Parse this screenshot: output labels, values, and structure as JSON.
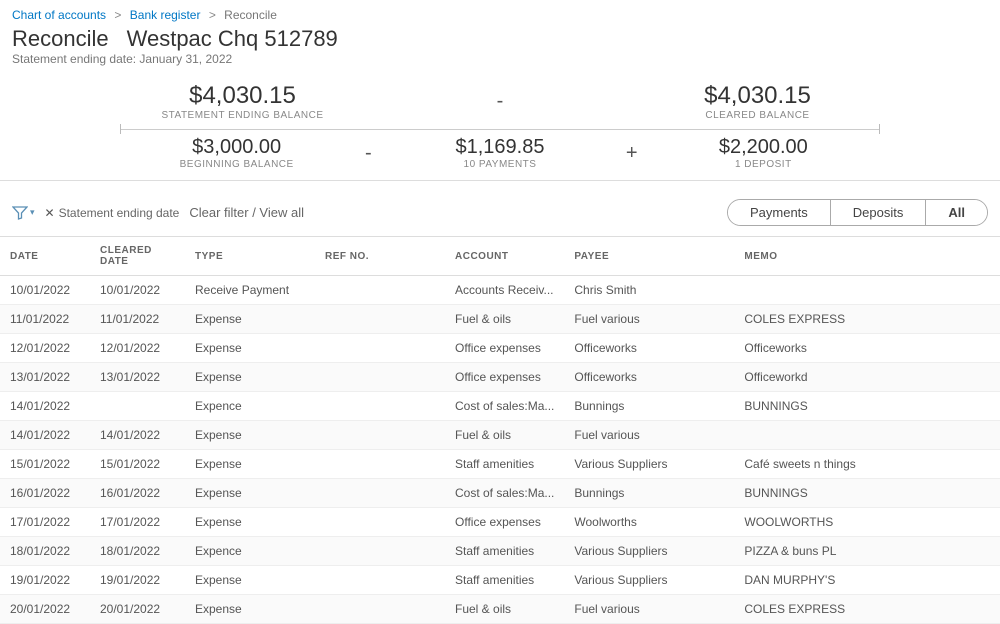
{
  "breadcrumb": {
    "chart": "Chart of accounts",
    "register": "Bank register",
    "current": "Reconcile"
  },
  "header": {
    "title": "Reconcile",
    "account": "Westpac Chq 512789",
    "statement_date_label": "Statement ending date: January 31, 2022"
  },
  "top_balances": {
    "ending": {
      "amount": "$4,030.15",
      "label": "STATEMENT ENDING BALANCE"
    },
    "op": "-",
    "cleared": {
      "amount": "$4,030.15",
      "label": "CLEARED BALANCE"
    }
  },
  "bottom_balances": {
    "beginning": {
      "amount": "$3,000.00",
      "label": "BEGINNING BALANCE"
    },
    "op1": "-",
    "payments": {
      "amount": "$1,169.85",
      "label": "10 PAYMENTS"
    },
    "op2": "+",
    "deposits": {
      "amount": "$2,200.00",
      "label": "1 DEPOSIT"
    }
  },
  "filters": {
    "chip_label": "Statement ending date",
    "clear_label": "Clear filter / View all"
  },
  "segmented": {
    "payments": "Payments",
    "deposits": "Deposits",
    "all": "All"
  },
  "columns": {
    "date": "DATE",
    "cleared": "CLEARED DATE",
    "type": "TYPE",
    "ref": "REF NO.",
    "account": "ACCOUNT",
    "payee": "PAYEE",
    "memo": "MEMO"
  },
  "rows": [
    {
      "date": "10/01/2022",
      "cleared": "10/01/2022",
      "type": "Receive Payment",
      "ref": "",
      "account": "Accounts Receiv...",
      "payee": "Chris Smith",
      "memo": ""
    },
    {
      "date": "11/01/2022",
      "cleared": "11/01/2022",
      "type": "Expense",
      "ref": "",
      "account": "Fuel & oils",
      "payee": "Fuel various",
      "memo": "COLES EXPRESS"
    },
    {
      "date": "12/01/2022",
      "cleared": "12/01/2022",
      "type": "Expense",
      "ref": "",
      "account": "Office expenses",
      "payee": "Officeworks",
      "memo": "Officeworks"
    },
    {
      "date": "13/01/2022",
      "cleared": "13/01/2022",
      "type": "Expense",
      "ref": "",
      "account": "Office expenses",
      "payee": "Officeworks",
      "memo": "Officeworkd"
    },
    {
      "date": "14/01/2022",
      "cleared": "",
      "type": "Expence",
      "ref": "",
      "account": "Cost of sales:Ma...",
      "payee": "Bunnings",
      "memo": "BUNNINGS"
    },
    {
      "date": "14/01/2022",
      "cleared": "14/01/2022",
      "type": "Expense",
      "ref": "",
      "account": "Fuel & oils",
      "payee": "Fuel various",
      "memo": ""
    },
    {
      "date": "15/01/2022",
      "cleared": "15/01/2022",
      "type": "Expense",
      "ref": "",
      "account": "Staff amenities",
      "payee": "Various Suppliers",
      "memo": "Café sweets n things"
    },
    {
      "date": "16/01/2022",
      "cleared": "16/01/2022",
      "type": "Expense",
      "ref": "",
      "account": "Cost of sales:Ma...",
      "payee": "Bunnings",
      "memo": "BUNNINGS"
    },
    {
      "date": "17/01/2022",
      "cleared": "17/01/2022",
      "type": "Expense",
      "ref": "",
      "account": "Office expenses",
      "payee": "Woolworths",
      "memo": "WOOLWORTHS"
    },
    {
      "date": "18/01/2022",
      "cleared": "18/01/2022",
      "type": "Expence",
      "ref": "",
      "account": "Staff amenities",
      "payee": "Various Suppliers",
      "memo": "PIZZA & buns PL"
    },
    {
      "date": "19/01/2022",
      "cleared": "19/01/2022",
      "type": "Expense",
      "ref": "",
      "account": "Staff amenities",
      "payee": "Various Suppliers",
      "memo": "DAN MURPHY'S"
    },
    {
      "date": "20/01/2022",
      "cleared": "20/01/2022",
      "type": "Expense",
      "ref": "",
      "account": "Fuel & oils",
      "payee": "Fuel various",
      "memo": "COLES EXPRESS"
    }
  ]
}
